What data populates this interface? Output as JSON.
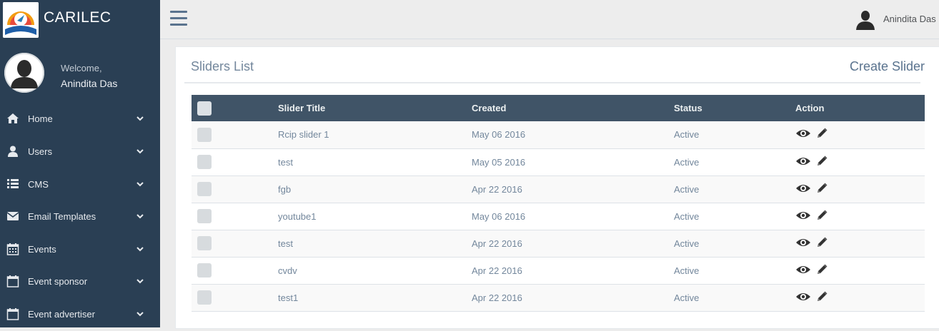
{
  "brand": {
    "title": "CARILEC",
    "logo_icon": "carilec-logo-icon"
  },
  "sidebar": {
    "welcome": "Welcome,",
    "user_name": "Anindita Das",
    "items": [
      {
        "label": "Home",
        "icon": "home-icon"
      },
      {
        "label": "Users",
        "icon": "user-icon"
      },
      {
        "label": "CMS",
        "icon": "list-icon"
      },
      {
        "label": "Email Templates",
        "icon": "envelope-icon"
      },
      {
        "label": "Events",
        "icon": "calendar-icon"
      },
      {
        "label": "Event sponsor",
        "icon": "calendar-icon"
      },
      {
        "label": "Event advertiser",
        "icon": "calendar-icon"
      }
    ]
  },
  "topbar": {
    "user_name": "Anindita Das"
  },
  "panel": {
    "title": "Sliders List",
    "create_label": "Create Slider"
  },
  "table": {
    "headers": {
      "title": "Slider Title",
      "created": "Created",
      "status": "Status",
      "action": "Action"
    },
    "rows": [
      {
        "title": "Rcip slider 1",
        "created": "May 06 2016",
        "status": "Active"
      },
      {
        "title": "test",
        "created": "May 05 2016",
        "status": "Active"
      },
      {
        "title": "fgb",
        "created": "Apr 22 2016",
        "status": "Active"
      },
      {
        "title": "youtube1",
        "created": "May 06 2016",
        "status": "Active"
      },
      {
        "title": "test",
        "created": "Apr 22 2016",
        "status": "Active"
      },
      {
        "title": "cvdv",
        "created": "Apr 22 2016",
        "status": "Active"
      },
      {
        "title": "test1",
        "created": "Apr 22 2016",
        "status": "Active"
      }
    ]
  },
  "colors": {
    "sidebar_bg": "#2a3f54",
    "table_header_bg": "#405467",
    "text_muted": "#73879c"
  }
}
